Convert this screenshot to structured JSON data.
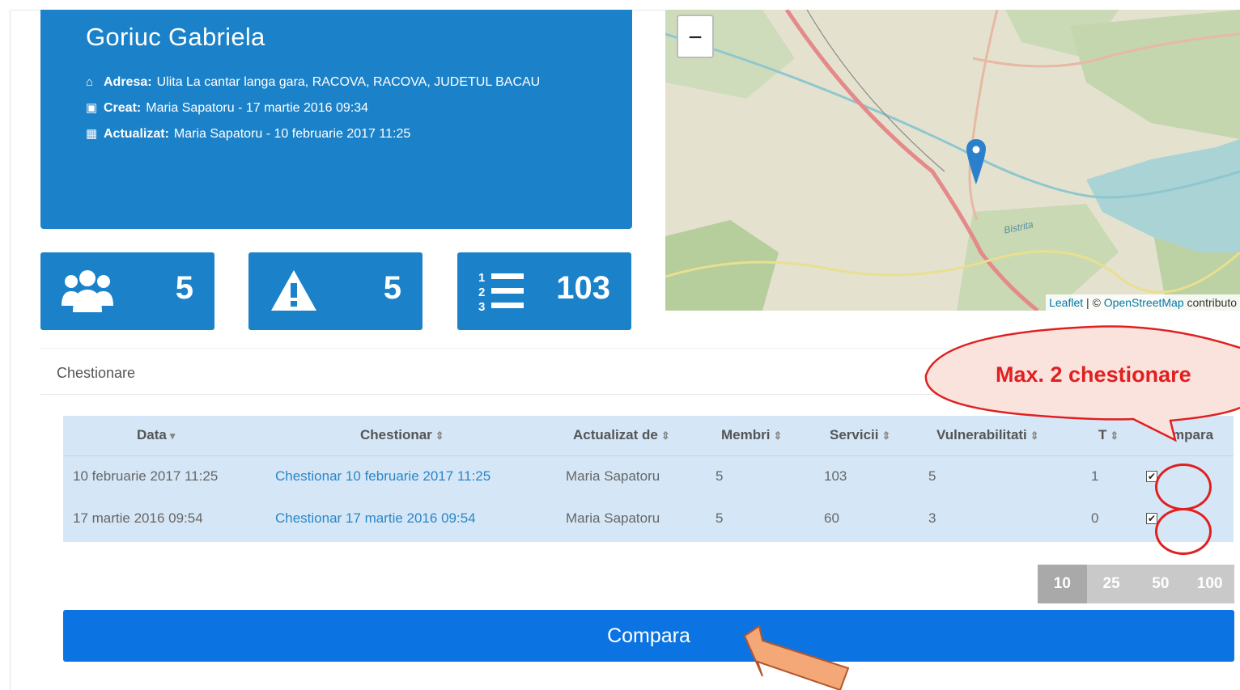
{
  "profile": {
    "name": "Goriuc Gabriela",
    "address_label": "Adresa:",
    "address_value": "Ulita La cantar langa gara, RACOVA, RACOVA, JUDETUL BACAU",
    "created_label": "Creat:",
    "created_value": "Maria Sapatoru - 17 martie 2016 09:34",
    "updated_label": "Actualizat:",
    "updated_value": "Maria Sapatoru - 10 februarie 2017 11:25",
    "icons": [
      "home-icon",
      "calendar-icon",
      "calendar-check-icon"
    ]
  },
  "stats": [
    {
      "icon": "users-icon",
      "value": "5"
    },
    {
      "icon": "warning-icon",
      "value": "5"
    },
    {
      "icon": "ordered-list-icon",
      "value": "103"
    }
  ],
  "map": {
    "zoom_out_label": "−",
    "river_label": "Bistrita",
    "attribution_leaflet": "Leaflet",
    "attribution_sep": " | © ",
    "attribution_osm": "OpenStreetMap",
    "attribution_rest": " contributo"
  },
  "panel": {
    "title": "Chestionare"
  },
  "table": {
    "columns": [
      {
        "label": "Data",
        "sort": "▾"
      },
      {
        "label": "Chestionar",
        "sort": "⇕"
      },
      {
        "label": "Actualizat de",
        "sort": "⇕"
      },
      {
        "label": "Membri",
        "sort": "⇕"
      },
      {
        "label": "Servicii",
        "sort": "⇕"
      },
      {
        "label": "Vulnerabilitati",
        "sort": "⇕"
      },
      {
        "label": "T",
        "sort": "⇕"
      },
      {
        "label": "mpara",
        "sort": ""
      }
    ],
    "rows": [
      {
        "data": "10 februarie 2017 11:25",
        "chestionar": "Chestionar 10 februarie 2017 11:25",
        "actualizat_de": "Maria Sapatoru",
        "membri": "5",
        "servicii": "103",
        "vulnerabilitati": "5",
        "t": "1",
        "checked": "✔"
      },
      {
        "data": "17 martie 2016 09:54",
        "chestionar": "Chestionar 17 martie 2016 09:54",
        "actualizat_de": "Maria Sapatoru",
        "membri": "5",
        "servicii": "60",
        "vulnerabilitati": "3",
        "t": "0",
        "checked": "✔"
      }
    ]
  },
  "pagination": {
    "options": [
      "10",
      "25",
      "50",
      "100"
    ],
    "selected": "10"
  },
  "compare_button": {
    "label": "Compara"
  },
  "annotation": {
    "callout": "Max. 2 chestionare"
  },
  "colors": {
    "primary": "#1b82c9",
    "button": "#0b74e2",
    "table_bg": "#d5e7f6",
    "annotation": "#e02020",
    "arrow": "#f4a878"
  }
}
